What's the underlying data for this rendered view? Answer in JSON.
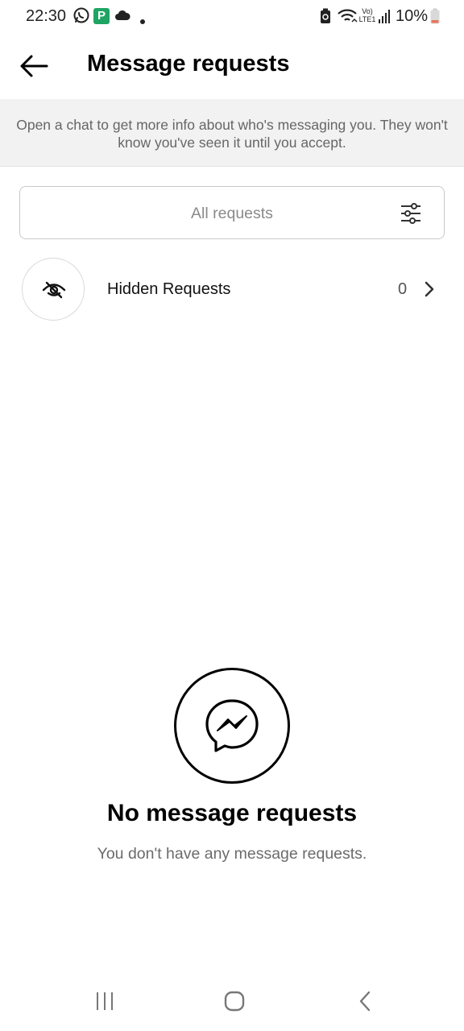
{
  "status_bar": {
    "time": "22:30",
    "battery": "10%",
    "icons": [
      "whatsapp-icon",
      "app-p-icon",
      "cloud-icon",
      "dot-icon",
      "battery-saver-icon",
      "wifi-icon",
      "volte-icon",
      "signal-icon",
      "battery-icon"
    ],
    "volte_top": "Vo)",
    "volte_bottom": "LTE1",
    "app_badge_letter": "P"
  },
  "header": {
    "title": "Message requests",
    "back_icon": "arrow-left-icon"
  },
  "info_banner": {
    "text": "Open a chat to get more info about who's messaging you. They won't know you've seen it until you accept."
  },
  "filter": {
    "label": "All requests",
    "icon": "sliders-icon"
  },
  "hidden_requests": {
    "label": "Hidden Requests",
    "count": "0",
    "icon": "eye-off-icon"
  },
  "empty_state": {
    "icon": "messenger-icon",
    "title": "No message requests",
    "subtitle": "You don't have any message requests."
  },
  "nav_bar": {
    "items": [
      "recent-apps-icon",
      "home-icon",
      "back-icon"
    ]
  },
  "colors": {
    "banner_bg": "#f2f2f2",
    "text_primary": "#000000",
    "text_secondary": "#666666",
    "battery_low": "#e8765c",
    "app_badge": "#1fa463"
  }
}
